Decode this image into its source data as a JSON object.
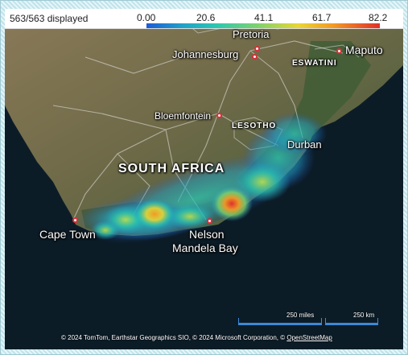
{
  "legend": {
    "count_text": "563/563 displayed",
    "ticks": [
      "0.00",
      "20.6",
      "41.1",
      "61.7",
      "82.2"
    ],
    "gradient_colors": [
      "#1f5bd6",
      "#1fa0c8",
      "#2cc7b0",
      "#7fd36a",
      "#e8d633",
      "#f29a24",
      "#e0302a"
    ]
  },
  "map": {
    "cities": {
      "pretoria": "Pretoria",
      "johannesburg": "Johannesburg",
      "maputo": "Maputo",
      "bloemfontein": "Bloemfontein",
      "durban": "Durban",
      "cape_town": "Cape Town",
      "nelson_mandela_bay_line1": "Nelson",
      "nelson_mandela_bay_line2": "Mandela Bay"
    },
    "countries": {
      "eswatini": "ESWATINI",
      "lesotho": "LESOTHO",
      "south_africa": "SOUTH AFRICA"
    },
    "scale": {
      "miles": "250 miles",
      "km": "250 km"
    },
    "copyright": {
      "text": "© 2024 TomTom, Earthstar Geographics SIO, © 2024 Microsoft Corporation, ©",
      "osm_link": "OpenStreetMap"
    },
    "heat_colors": {
      "low": "#1fa0c8",
      "mid": "#7fd36a",
      "high": "#f29a24",
      "peak": "#e0302a"
    }
  }
}
